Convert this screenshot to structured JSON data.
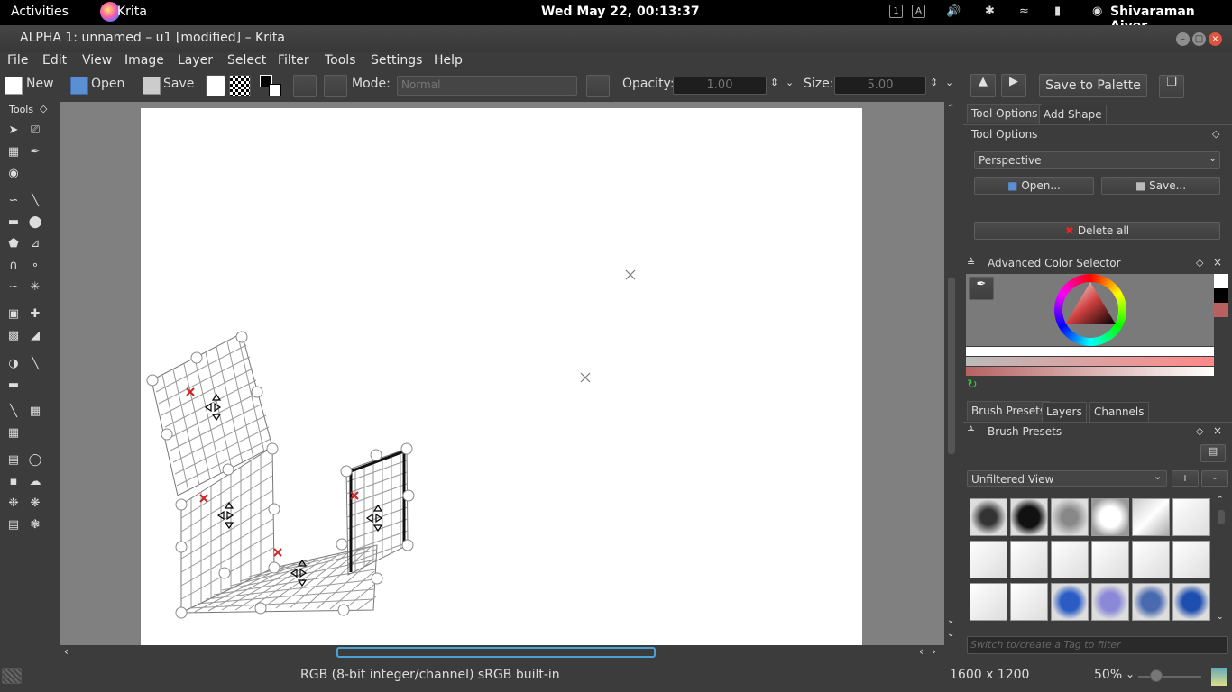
{
  "topbar": {
    "activities": "Activities",
    "app": "Krita",
    "clock": "Wed May 22, 00:13:37",
    "kbd1": "1",
    "kbd2": "A",
    "user": "Shivaraman Aiyer"
  },
  "window": {
    "title": "ALPHA 1: unnamed – u1 [modified] – Krita"
  },
  "menu": [
    "File",
    "Edit",
    "View",
    "Image",
    "Layer",
    "Select",
    "Filter",
    "Tools",
    "Settings",
    "Help"
  ],
  "toolbar": {
    "new": "New",
    "open": "Open",
    "save": "Save",
    "mode_label": "Mode:",
    "mode_value": "Normal",
    "opacity_label": "Opacity:",
    "opacity_value": "1.00",
    "size_label": "Size:",
    "size_value": "5.00",
    "save_palette": "Save to Palette"
  },
  "toolbox": {
    "title": "Tools"
  },
  "dock": {
    "tab_tool_options": "Tool Options",
    "tab_add_shape": "Add Shape",
    "tool_options_title": "Tool Options",
    "assistant_type": "Perspective",
    "open_btn": "Open...",
    "save_btn": "Save...",
    "delete_all": "Delete all",
    "color_selector_title": "Advanced Color Selector",
    "tab_brush_presets": "Brush Presets",
    "tab_layers": "Layers",
    "tab_channels": "Channels",
    "brush_presets_title": "Brush Presets",
    "filter_view": "Unfiltered View",
    "plus": "+",
    "minus": "-",
    "tag_placeholder": "Switch to/create a Tag to filter"
  },
  "status": {
    "color_info": "RGB (8-bit integer/channel)  sRGB built-in",
    "dimensions": "1600 x 1200",
    "zoom": "50%"
  },
  "colors": {
    "accent": "#4aa3d8",
    "assistant_red": "#cc2222",
    "background": "#3c3c3c",
    "canvas_bg": "#808080"
  }
}
